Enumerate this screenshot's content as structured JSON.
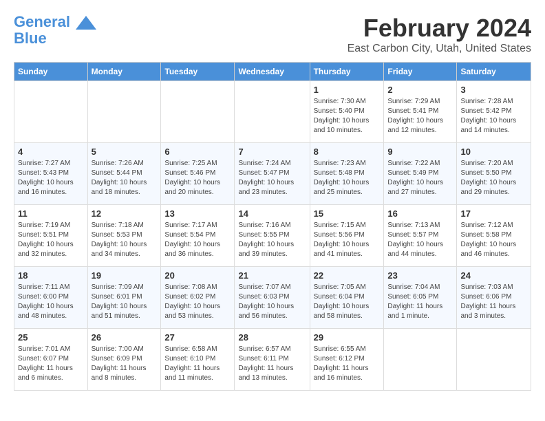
{
  "header": {
    "logo_line1": "General",
    "logo_line2": "Blue",
    "title": "February 2024",
    "subtitle": "East Carbon City, Utah, United States"
  },
  "days_of_week": [
    "Sunday",
    "Monday",
    "Tuesday",
    "Wednesday",
    "Thursday",
    "Friday",
    "Saturday"
  ],
  "weeks": [
    [
      {
        "day": "",
        "info": ""
      },
      {
        "day": "",
        "info": ""
      },
      {
        "day": "",
        "info": ""
      },
      {
        "day": "",
        "info": ""
      },
      {
        "day": "1",
        "info": "Sunrise: 7:30 AM\nSunset: 5:40 PM\nDaylight: 10 hours\nand 10 minutes."
      },
      {
        "day": "2",
        "info": "Sunrise: 7:29 AM\nSunset: 5:41 PM\nDaylight: 10 hours\nand 12 minutes."
      },
      {
        "day": "3",
        "info": "Sunrise: 7:28 AM\nSunset: 5:42 PM\nDaylight: 10 hours\nand 14 minutes."
      }
    ],
    [
      {
        "day": "4",
        "info": "Sunrise: 7:27 AM\nSunset: 5:43 PM\nDaylight: 10 hours\nand 16 minutes."
      },
      {
        "day": "5",
        "info": "Sunrise: 7:26 AM\nSunset: 5:44 PM\nDaylight: 10 hours\nand 18 minutes."
      },
      {
        "day": "6",
        "info": "Sunrise: 7:25 AM\nSunset: 5:46 PM\nDaylight: 10 hours\nand 20 minutes."
      },
      {
        "day": "7",
        "info": "Sunrise: 7:24 AM\nSunset: 5:47 PM\nDaylight: 10 hours\nand 23 minutes."
      },
      {
        "day": "8",
        "info": "Sunrise: 7:23 AM\nSunset: 5:48 PM\nDaylight: 10 hours\nand 25 minutes."
      },
      {
        "day": "9",
        "info": "Sunrise: 7:22 AM\nSunset: 5:49 PM\nDaylight: 10 hours\nand 27 minutes."
      },
      {
        "day": "10",
        "info": "Sunrise: 7:20 AM\nSunset: 5:50 PM\nDaylight: 10 hours\nand 29 minutes."
      }
    ],
    [
      {
        "day": "11",
        "info": "Sunrise: 7:19 AM\nSunset: 5:51 PM\nDaylight: 10 hours\nand 32 minutes."
      },
      {
        "day": "12",
        "info": "Sunrise: 7:18 AM\nSunset: 5:53 PM\nDaylight: 10 hours\nand 34 minutes."
      },
      {
        "day": "13",
        "info": "Sunrise: 7:17 AM\nSunset: 5:54 PM\nDaylight: 10 hours\nand 36 minutes."
      },
      {
        "day": "14",
        "info": "Sunrise: 7:16 AM\nSunset: 5:55 PM\nDaylight: 10 hours\nand 39 minutes."
      },
      {
        "day": "15",
        "info": "Sunrise: 7:15 AM\nSunset: 5:56 PM\nDaylight: 10 hours\nand 41 minutes."
      },
      {
        "day": "16",
        "info": "Sunrise: 7:13 AM\nSunset: 5:57 PM\nDaylight: 10 hours\nand 44 minutes."
      },
      {
        "day": "17",
        "info": "Sunrise: 7:12 AM\nSunset: 5:58 PM\nDaylight: 10 hours\nand 46 minutes."
      }
    ],
    [
      {
        "day": "18",
        "info": "Sunrise: 7:11 AM\nSunset: 6:00 PM\nDaylight: 10 hours\nand 48 minutes."
      },
      {
        "day": "19",
        "info": "Sunrise: 7:09 AM\nSunset: 6:01 PM\nDaylight: 10 hours\nand 51 minutes."
      },
      {
        "day": "20",
        "info": "Sunrise: 7:08 AM\nSunset: 6:02 PM\nDaylight: 10 hours\nand 53 minutes."
      },
      {
        "day": "21",
        "info": "Sunrise: 7:07 AM\nSunset: 6:03 PM\nDaylight: 10 hours\nand 56 minutes."
      },
      {
        "day": "22",
        "info": "Sunrise: 7:05 AM\nSunset: 6:04 PM\nDaylight: 10 hours\nand 58 minutes."
      },
      {
        "day": "23",
        "info": "Sunrise: 7:04 AM\nSunset: 6:05 PM\nDaylight: 11 hours\nand 1 minute."
      },
      {
        "day": "24",
        "info": "Sunrise: 7:03 AM\nSunset: 6:06 PM\nDaylight: 11 hours\nand 3 minutes."
      }
    ],
    [
      {
        "day": "25",
        "info": "Sunrise: 7:01 AM\nSunset: 6:07 PM\nDaylight: 11 hours\nand 6 minutes."
      },
      {
        "day": "26",
        "info": "Sunrise: 7:00 AM\nSunset: 6:09 PM\nDaylight: 11 hours\nand 8 minutes."
      },
      {
        "day": "27",
        "info": "Sunrise: 6:58 AM\nSunset: 6:10 PM\nDaylight: 11 hours\nand 11 minutes."
      },
      {
        "day": "28",
        "info": "Sunrise: 6:57 AM\nSunset: 6:11 PM\nDaylight: 11 hours\nand 13 minutes."
      },
      {
        "day": "29",
        "info": "Sunrise: 6:55 AM\nSunset: 6:12 PM\nDaylight: 11 hours\nand 16 minutes."
      },
      {
        "day": "",
        "info": ""
      },
      {
        "day": "",
        "info": ""
      }
    ]
  ]
}
